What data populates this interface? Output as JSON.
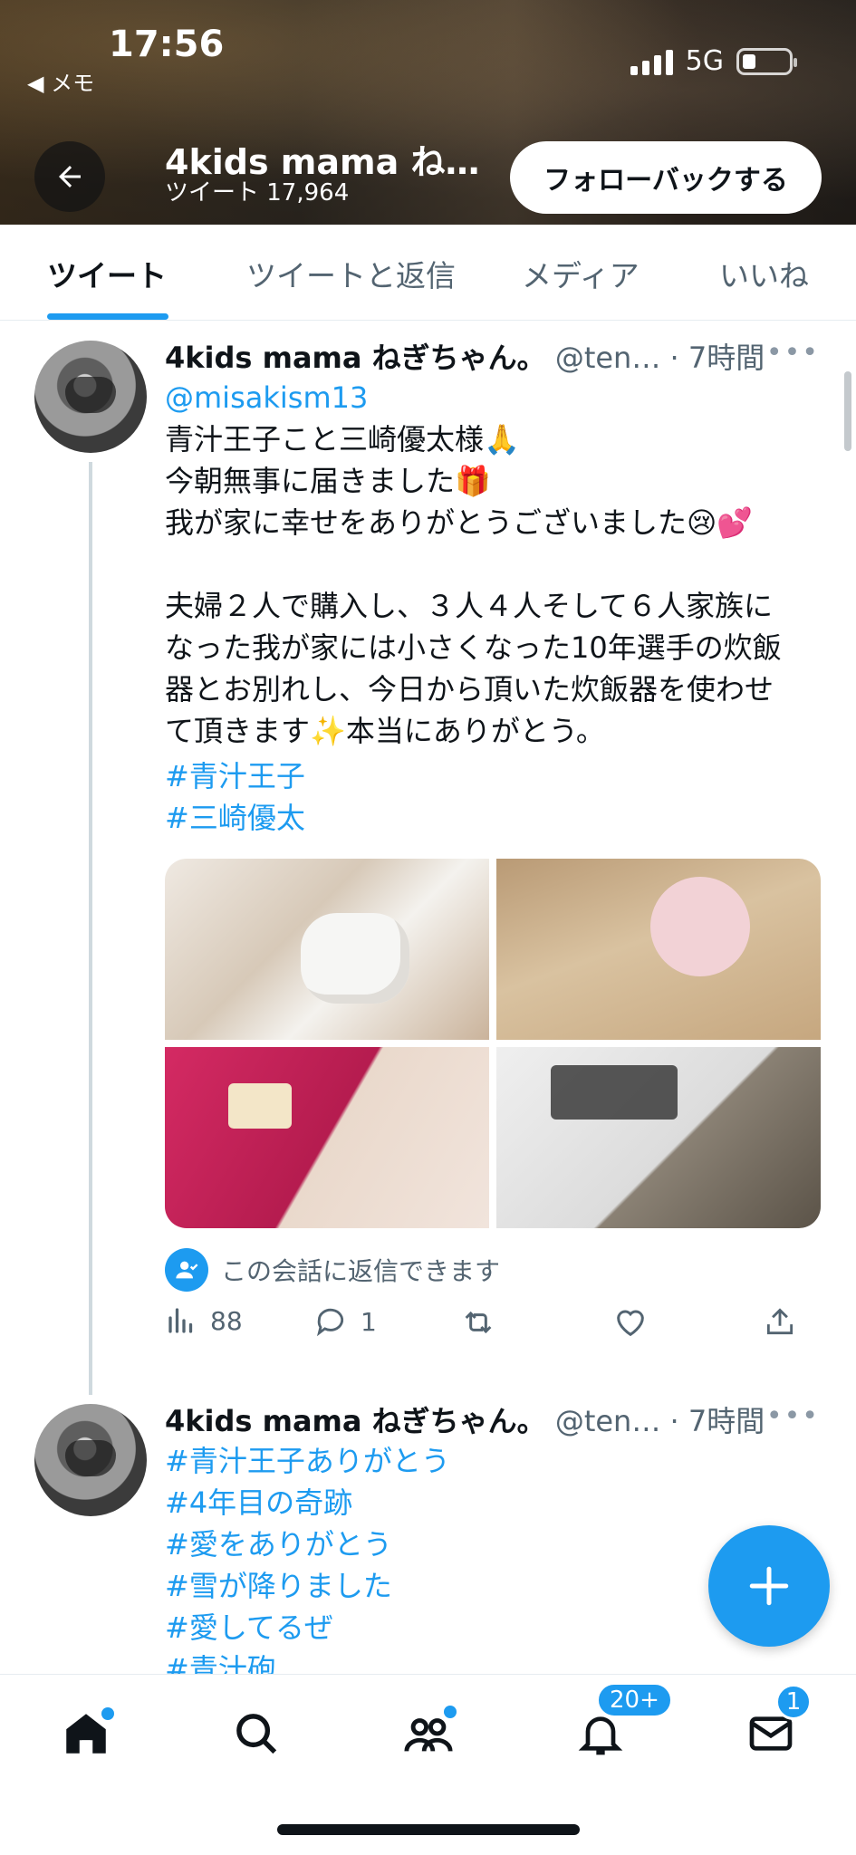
{
  "status_bar": {
    "time": "17:56",
    "back_app": "◀ メモ",
    "network": "5G"
  },
  "header": {
    "profile_name": "4kids mama ね…",
    "tweet_count": "ツイート 17,964",
    "follow_button": "フォローバックする"
  },
  "tabs": [
    {
      "label": "ツイート",
      "active": true
    },
    {
      "label": "ツイートと返信",
      "active": false
    },
    {
      "label": "メディア",
      "active": false
    },
    {
      "label": "いいね",
      "active": false
    }
  ],
  "tweets": [
    {
      "display_name": "4kids mama ねぎちゃん。",
      "handle_time": " @ten… · 7時間",
      "more": "•••",
      "mention": "@misakism13",
      "lines": [
        "青汁王子こと三崎優太様🙏",
        "今朝無事に届きました🎁",
        "我が家に幸せをありがとうございました😢💕",
        "",
        "夫婦２人で購入し、３人４人そして６人家族に",
        "なった我が家には小さくなった10年選手の炊飯",
        "器とお別れし、今日から頂いた炊飯器を使わせ",
        "て頂きます✨本当にありがとう。"
      ],
      "hashtags": [
        "#青汁王子",
        "#三崎優太"
      ],
      "reply_notice": "この会話に返信できます",
      "views": "88",
      "replies": "1"
    },
    {
      "display_name": "4kids mama ねぎちゃん。",
      "handle_time": " @ten… · 7時間",
      "more": "•••",
      "hashtags": [
        "#青汁王子ありがとう",
        "#4年目の奇跡",
        "#愛をありがとう",
        "#雪が降りました",
        "#愛してるぜ",
        "#青汁砲"
      ]
    }
  ],
  "bottom_nav": {
    "notifications_badge": "20+",
    "messages_badge": "1"
  },
  "colors": {
    "accent": "#1d9bf0",
    "text": "#0f1419",
    "muted": "#536471"
  }
}
